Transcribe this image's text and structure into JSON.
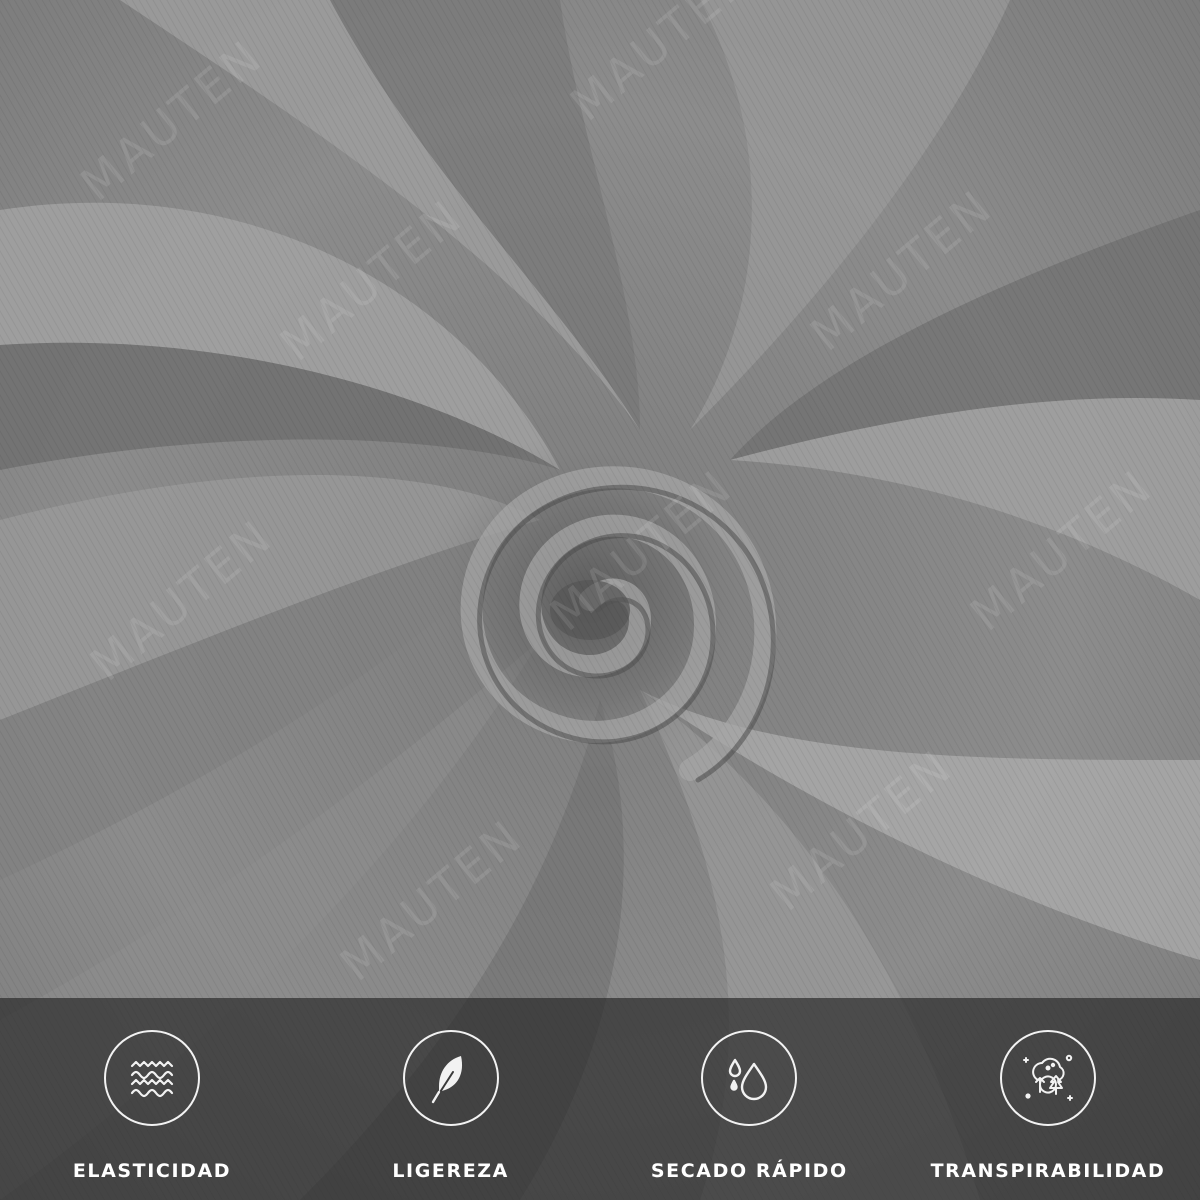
{
  "image": {
    "subject": "grey-twill-fabric-swirl",
    "colors": {
      "fabric_base": "#8a8a8a",
      "fabric_light": "#a3a3a3",
      "fabric_shadow": "#5e5e5e",
      "bar_bg": "#2a2a2a",
      "label": "#ffffff"
    }
  },
  "watermark": {
    "text": "MAUTEN"
  },
  "features": [
    {
      "label": "ELASTICIDAD",
      "icon": "waves-icon"
    },
    {
      "label": "LIGEREZA",
      "icon": "feather-icon"
    },
    {
      "label": "SECADO RÁPIDO",
      "icon": "water-drops-icon"
    },
    {
      "label": "TRANSPIRABILIDAD",
      "icon": "breathable-trees-icon"
    }
  ]
}
